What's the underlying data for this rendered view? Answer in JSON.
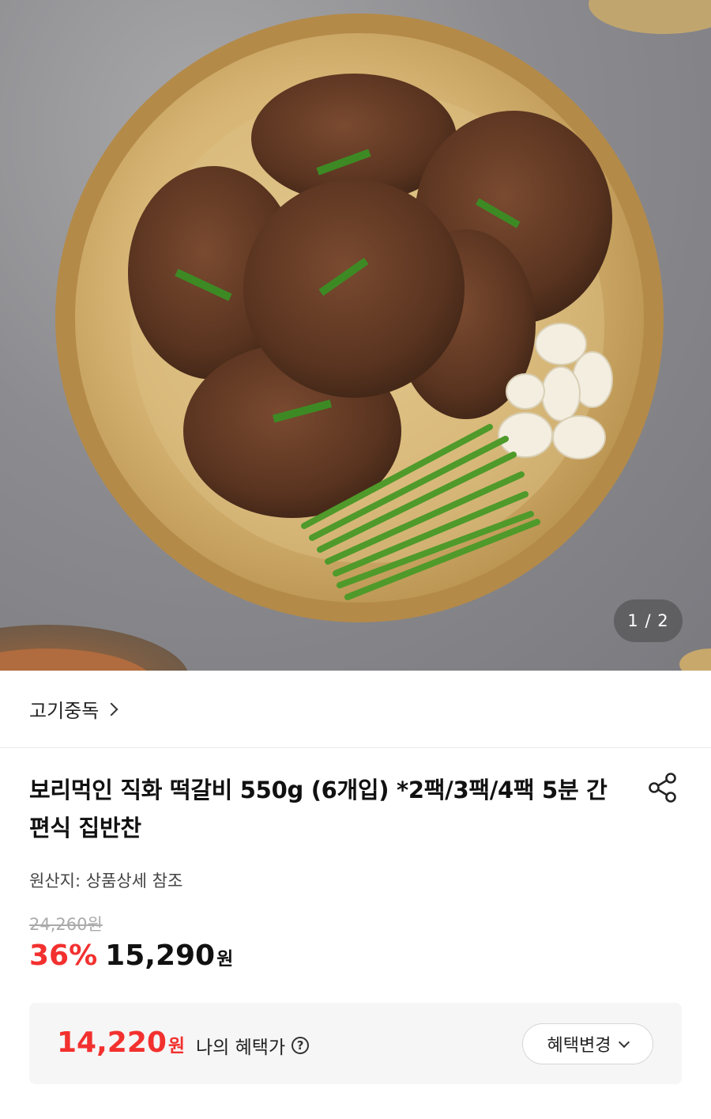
{
  "image": {
    "page_indicator": "1 / 2",
    "current_page": 1,
    "total_pages": 2
  },
  "store": {
    "name": "고기중독"
  },
  "product": {
    "title": "보리먹인 직화 떡갈비 550g (6개입) *2팩/3팩/4팩 5분 간편식 집반찬",
    "origin": "원산지: 상품상세 참조",
    "original_price": "24,260원",
    "discount": "36%",
    "price": "15,290",
    "currency": "원"
  },
  "benefit": {
    "price": "14,220",
    "currency": "원",
    "label": "나의 혜택가",
    "help_icon": "?",
    "change_button": "혜택변경"
  },
  "colors": {
    "accent_red": "#f2312f",
    "benefit_bg": "#f6f6f6"
  }
}
